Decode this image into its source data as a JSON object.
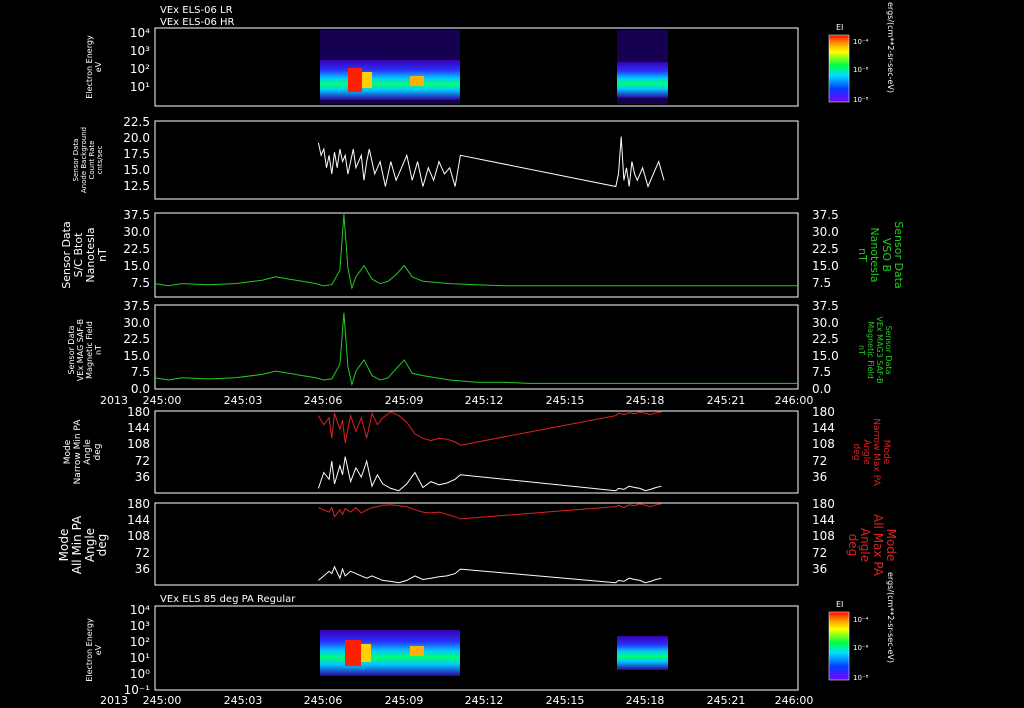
{
  "header": {
    "line1": "VEx ELS-06 LR",
    "line2": "VEx ELS-06 HR"
  },
  "x_axis": {
    "year": "2013",
    "ticks": [
      "245:00",
      "245:03",
      "245:06",
      "245:09",
      "245:12",
      "245:15",
      "245:18",
      "245:21",
      "246:00"
    ],
    "range_minutes": [
      0,
      24
    ]
  },
  "colors": {
    "axis": "#ffffff",
    "green": "#22cc22",
    "red": "#dd2222",
    "white": "#ffffff"
  },
  "colorbar": {
    "title": "EI",
    "ticks": [
      "10⁻⁴",
      "10⁻⁶",
      "10⁻⁸"
    ],
    "units": "ergs/(cm**2-sr-sec-eV)"
  },
  "panels": {
    "spec_top": {
      "ylabel": [
        "Electron Energy",
        "eV"
      ],
      "yticks": [
        "10⁴",
        "10³",
        "10²",
        "10¹"
      ]
    },
    "background": {
      "ylabel": [
        "Sensor Data",
        "Anode Background",
        "Count Rate",
        "cnts/sec"
      ],
      "yticks": [
        "22.5",
        "20.0",
        "17.5",
        "15.0",
        "12.5"
      ]
    },
    "btot": {
      "ylabel_left": [
        "Sensor Data",
        "S/C Btot",
        "Nanotesla",
        "nT"
      ],
      "ylabel_right": [
        "Sensor Data",
        "VSO B",
        "Nanotesla",
        "nT"
      ],
      "yticks": [
        "37.5",
        "30.0",
        "22.5",
        "15.0",
        "7.5"
      ]
    },
    "mag": {
      "ylabel_left": [
        "Sensor Data",
        "VEx MAG SAF-B",
        "Magnetic Field",
        "nT"
      ],
      "ylabel_right": [
        "Sensor Data",
        "VEx MAG3 SAF-B",
        "Magnetic Field",
        "nT"
      ],
      "yticks": [
        "37.5",
        "30.0",
        "22.5",
        "15.0",
        "7.5",
        "0.0"
      ]
    },
    "narrow_pa": {
      "ylabel_left": [
        "Mode",
        "Narrow Min PA",
        "Angle",
        "deg"
      ],
      "ylabel_right": [
        "Mode",
        "Narrow Max PA",
        "Angle",
        "deg"
      ],
      "yticks": [
        "180",
        "144",
        "108",
        "72",
        "36"
      ]
    },
    "all_pa": {
      "ylabel_left": [
        "Mode",
        "All Min PA",
        "Angle",
        "deg"
      ],
      "ylabel_right": [
        "Mode",
        "All Max PA",
        "Angle",
        "deg"
      ],
      "yticks": [
        "180",
        "144",
        "108",
        "72",
        "36"
      ]
    },
    "spec_bottom": {
      "title": "VEx ELS 85 deg PA Regular",
      "ylabel": [
        "Electron Energy",
        "eV"
      ],
      "yticks": [
        "10⁴",
        "10³",
        "10²",
        "10¹",
        "10⁰",
        "10⁻¹"
      ]
    }
  },
  "chart_data": {
    "type": "line",
    "x_unit": "minutes after 245:00 (2013 DOY 245)",
    "series": [
      {
        "key": "btot",
        "color": "#22cc22",
        "ylim": [
          0,
          37.5
        ],
        "x": [
          0,
          0.5,
          1,
          2,
          3,
          4,
          4.5,
          5,
          5.5,
          6,
          6.3,
          6.6,
          6.9,
          7.05,
          7.2,
          7.35,
          7.5,
          7.8,
          8.1,
          8.4,
          8.7,
          9.0,
          9.3,
          9.6,
          10,
          11,
          12,
          13,
          14,
          15,
          16,
          17,
          18,
          19,
          20,
          21,
          22,
          23,
          24
        ],
        "y": [
          6,
          5,
          6,
          5.5,
          6,
          7.5,
          9,
          8,
          7,
          6,
          5,
          5.5,
          12,
          37,
          13,
          4,
          9,
          14,
          8,
          6,
          7,
          10,
          14,
          9,
          7,
          6,
          5.5,
          5,
          5,
          5,
          5,
          5,
          5,
          5,
          5,
          5,
          5,
          5,
          5
        ]
      },
      {
        "key": "mag",
        "color": "#22cc22",
        "ylim": [
          0,
          37.5
        ],
        "x": [
          0,
          0.5,
          1,
          2,
          3,
          4,
          4.5,
          5,
          5.5,
          6,
          6.3,
          6.6,
          6.9,
          7.05,
          7.2,
          7.35,
          7.5,
          7.8,
          8.1,
          8.4,
          8.7,
          9.0,
          9.3,
          9.6,
          10,
          11,
          12,
          13,
          14,
          15,
          16,
          17,
          18,
          19,
          20,
          21,
          22,
          23,
          24
        ],
        "y": [
          5,
          4,
          5,
          4.5,
          5,
          6.5,
          8,
          7,
          6,
          5,
          4,
          4.5,
          11,
          34,
          10,
          2,
          8,
          13,
          6,
          4,
          5,
          9,
          13,
          7,
          6,
          4,
          3,
          3,
          2.5,
          2.5,
          2.5,
          2.5,
          2.5,
          2.5,
          2.5,
          2.5,
          2.5,
          2.5,
          2.5
        ]
      },
      {
        "key": "background",
        "color": "#ffffff",
        "ylim": [
          10,
          22.5
        ],
        "x": [
          6.1,
          6.2,
          6.3,
          6.4,
          6.5,
          6.6,
          6.7,
          6.8,
          6.9,
          7.0,
          7.1,
          7.2,
          7.3,
          7.4,
          7.5,
          7.6,
          7.7,
          7.8,
          7.9,
          8.0,
          8.2,
          8.4,
          8.6,
          8.8,
          9.0,
          9.2,
          9.4,
          9.6,
          9.8,
          10.0,
          10.2,
          10.4,
          10.6,
          10.8,
          11.0,
          11.2,
          11.4,
          17.2,
          17.3,
          17.4,
          17.5,
          17.6,
          17.7,
          17.8,
          17.9,
          18.0,
          18.2,
          18.4,
          18.6,
          18.8,
          19.0
        ],
        "y": [
          19,
          17,
          18,
          15,
          17,
          14,
          17.5,
          15,
          18,
          16,
          17,
          14,
          16,
          18,
          15,
          16,
          17,
          13,
          16,
          18,
          14,
          16,
          12,
          16,
          13,
          15,
          17,
          13,
          16,
          12,
          15,
          13,
          16,
          14,
          15,
          12,
          17,
          12,
          14,
          20,
          13,
          15,
          12,
          16,
          14,
          13,
          15,
          12,
          14,
          16,
          13
        ]
      },
      {
        "key": "narrow_min",
        "color": "#ffffff",
        "ylim": [
          0,
          180
        ],
        "x": [
          6.1,
          6.3,
          6.5,
          6.6,
          6.7,
          6.9,
          7.0,
          7.1,
          7.3,
          7.5,
          7.7,
          7.9,
          8.1,
          8.3,
          8.5,
          8.8,
          9.1,
          9.4,
          9.7,
          10.0,
          10.3,
          10.6,
          10.9,
          11.2,
          11.4,
          17.2,
          17.3,
          17.5,
          17.7,
          17.9,
          18.1,
          18.3,
          18.5,
          18.7,
          18.9
        ],
        "y": [
          10,
          45,
          30,
          70,
          20,
          60,
          40,
          80,
          25,
          55,
          35,
          70,
          15,
          40,
          20,
          10,
          5,
          20,
          45,
          12,
          25,
          18,
          22,
          30,
          40,
          5,
          10,
          8,
          15,
          12,
          10,
          5,
          8,
          12,
          15
        ]
      },
      {
        "key": "narrow_max",
        "color": "#dd2222",
        "ylim": [
          0,
          180
        ],
        "x": [
          6.1,
          6.3,
          6.5,
          6.6,
          6.7,
          6.9,
          7.0,
          7.1,
          7.3,
          7.5,
          7.7,
          7.9,
          8.1,
          8.3,
          8.5,
          8.8,
          9.1,
          9.4,
          9.7,
          10.0,
          10.3,
          10.6,
          10.9,
          11.2,
          11.4,
          17.2,
          17.3,
          17.5,
          17.7,
          17.9,
          18.1,
          18.3,
          18.5,
          18.7,
          18.9
        ],
        "y": [
          170,
          150,
          165,
          120,
          175,
          140,
          160,
          110,
          170,
          135,
          165,
          120,
          175,
          150,
          165,
          178,
          170,
          155,
          130,
          120,
          115,
          120,
          118,
          112,
          105,
          170,
          175,
          172,
          176,
          174,
          178,
          175,
          172,
          176,
          178
        ]
      },
      {
        "key": "all_min",
        "color": "#ffffff",
        "ylim": [
          0,
          180
        ],
        "x": [
          6.1,
          6.3,
          6.5,
          6.6,
          6.7,
          6.9,
          7.0,
          7.1,
          7.3,
          7.5,
          7.7,
          7.9,
          8.1,
          8.3,
          8.5,
          8.8,
          9.1,
          9.4,
          9.7,
          10.0,
          10.3,
          10.6,
          10.9,
          11.2,
          11.4,
          17.2,
          17.3,
          17.5,
          17.7,
          17.9,
          18.1,
          18.3,
          18.5,
          18.7,
          18.9
        ],
        "y": [
          10,
          20,
          30,
          25,
          40,
          15,
          35,
          20,
          30,
          25,
          20,
          15,
          20,
          15,
          10,
          8,
          5,
          10,
          20,
          12,
          15,
          18,
          20,
          25,
          35,
          5,
          10,
          8,
          15,
          12,
          10,
          5,
          8,
          12,
          15
        ]
      },
      {
        "key": "all_max",
        "color": "#dd2222",
        "ylim": [
          0,
          180
        ],
        "x": [
          6.1,
          6.3,
          6.5,
          6.6,
          6.7,
          6.9,
          7.0,
          7.1,
          7.3,
          7.5,
          7.7,
          7.9,
          8.1,
          8.3,
          8.5,
          8.8,
          9.1,
          9.4,
          9.7,
          10.0,
          10.3,
          10.6,
          10.9,
          11.2,
          11.4,
          17.2,
          17.3,
          17.5,
          17.7,
          17.9,
          18.1,
          18.3,
          18.5,
          18.7,
          18.9
        ],
        "y": [
          170,
          165,
          160,
          170,
          150,
          165,
          155,
          168,
          160,
          170,
          158,
          165,
          170,
          172,
          175,
          176,
          174,
          172,
          165,
          160,
          158,
          160,
          155,
          150,
          145,
          172,
          175,
          170,
          176,
          174,
          178,
          175,
          172,
          176,
          178
        ]
      }
    ],
    "spectrograms": {
      "top": {
        "active_intervals_minutes": [
          [
            6.1,
            11.4
          ],
          [
            17.2,
            19.0
          ]
        ]
      },
      "bottom": {
        "active_intervals_minutes": [
          [
            6.1,
            11.4
          ],
          [
            17.2,
            19.0
          ]
        ]
      }
    }
  }
}
